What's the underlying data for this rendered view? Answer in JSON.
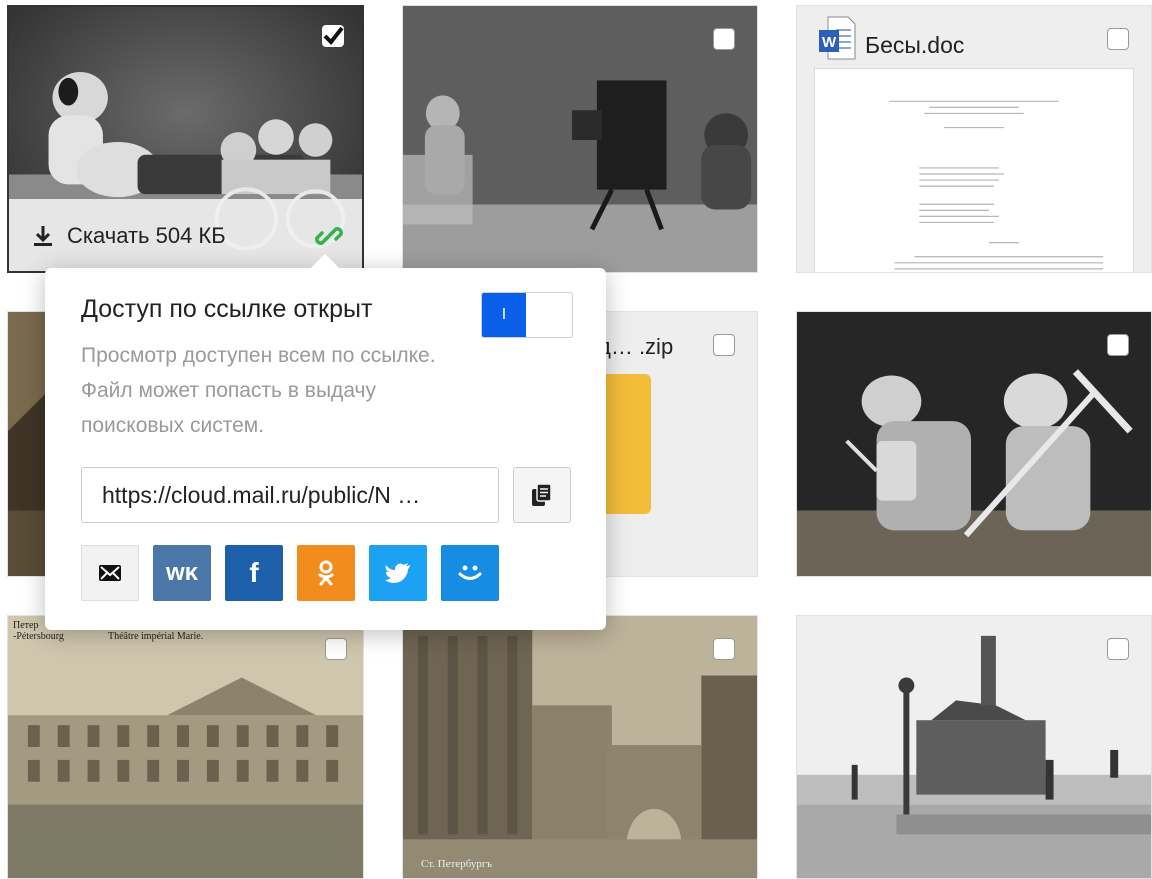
{
  "tiles": {
    "top_left": {
      "download_label": "Скачать 504 КБ",
      "checked": true
    },
    "doc": {
      "name": "Бесы.doc"
    },
    "zip": {
      "name_visible": "д… .zip"
    }
  },
  "share_popup": {
    "title": "Доступ по ссылке открыт",
    "toggle_label": "I",
    "description": "Просмотр доступен всем по ссылке. Файл может попасть в выдачу поисковых систем.",
    "url": "https://cloud.mail.ru/public/N …",
    "buttons": [
      {
        "name": "email",
        "icon": "mail-icon",
        "color": "#f2f2f2"
      },
      {
        "name": "vkontakte",
        "icon": "vk-icon",
        "color": "#4a76a8"
      },
      {
        "name": "facebook",
        "icon": "facebook-icon",
        "color": "#1d5fa8"
      },
      {
        "name": "odnoklassniki",
        "icon": "ok-icon",
        "color": "#f28c1c"
      },
      {
        "name": "twitter",
        "icon": "twitter-icon",
        "color": "#1da1f2"
      },
      {
        "name": "moy-mir",
        "icon": "mymail-smile-icon",
        "color": "#168de2"
      }
    ],
    "share_texts": {
      "vk": "ᴡᴋ",
      "fb": "f"
    }
  },
  "postcards": {
    "theatre_caption_left": "Петер",
    "theatre_caption_left2": "-Pétersbourg",
    "theatre_caption": "Théâtre impérial Marie.",
    "street_caption": "Ст. Петербургъ"
  },
  "colors": {
    "accent": "#0a5fe8",
    "folder_yellow": "#f3bd3a"
  }
}
